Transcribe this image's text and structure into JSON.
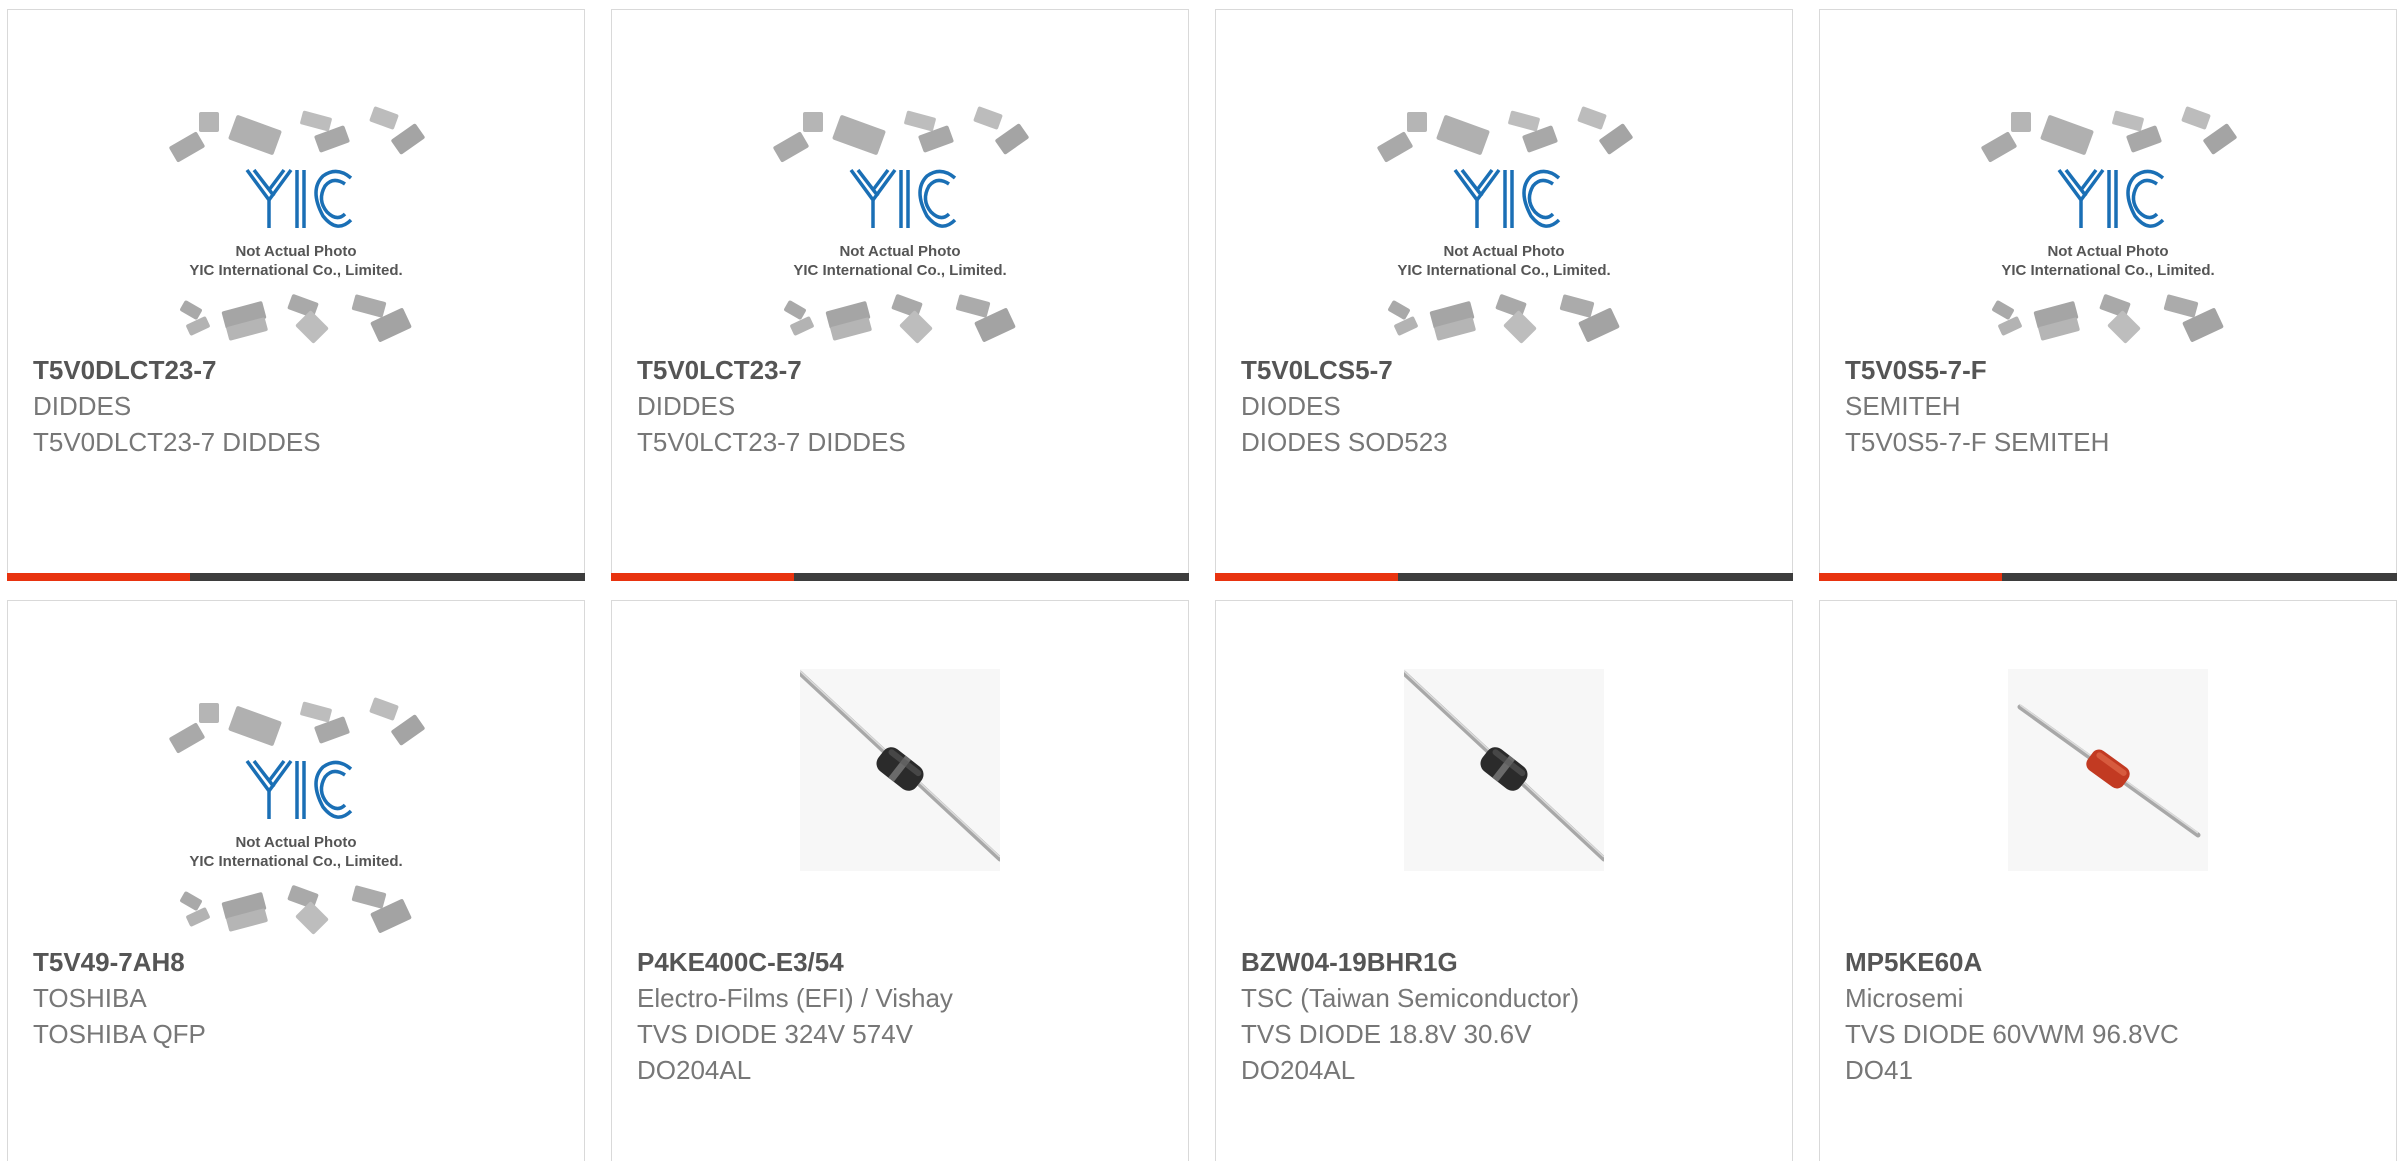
{
  "placeholder_image": {
    "line1": "Not Actual Photo",
    "line2": "YIC International Co., Limited.",
    "logo_text": "YIC"
  },
  "products": [
    {
      "part": "T5V0DLCT23-7",
      "maker": "DIDDES",
      "desc_lines": [
        "T5V0DLCT23-7 DIDDES"
      ],
      "image": "placeholder"
    },
    {
      "part": "T5V0LCT23-7",
      "maker": "DIDDES",
      "desc_lines": [
        "T5V0LCT23-7 DIDDES"
      ],
      "image": "placeholder"
    },
    {
      "part": "T5V0LCS5-7",
      "maker": "DIODES",
      "desc_lines": [
        "DIODES SOD523"
      ],
      "image": "placeholder"
    },
    {
      "part": "T5V0S5-7-F",
      "maker": "SEMITEH",
      "desc_lines": [
        "T5V0S5-7-F SEMITEH"
      ],
      "image": "placeholder"
    },
    {
      "part": "T5V49-7AH8",
      "maker": "TOSHIBA",
      "desc_lines": [
        "TOSHIBA QFP"
      ],
      "image": "placeholder"
    },
    {
      "part": "P4KE400C-E3/54",
      "maker": "Electro-Films (EFI) / Vishay",
      "desc_lines": [
        "TVS DIODE 324V 574V",
        "DO204AL"
      ],
      "image": "diode-black"
    },
    {
      "part": "BZW04-19BHR1G",
      "maker": "TSC (Taiwan Semiconductor)",
      "desc_lines": [
        "TVS DIODE 18.8V 30.6V",
        "DO204AL"
      ],
      "image": "diode-black"
    },
    {
      "part": "MP5KE60A",
      "maker": "Microsemi",
      "desc_lines": [
        "TVS DIODE 60VWM 96.8VC",
        "DO41"
      ],
      "image": "diode-red"
    }
  ],
  "colors": {
    "accent": "#e8330f",
    "bar": "#3d3d3d",
    "logo": "#1a6fb5"
  }
}
